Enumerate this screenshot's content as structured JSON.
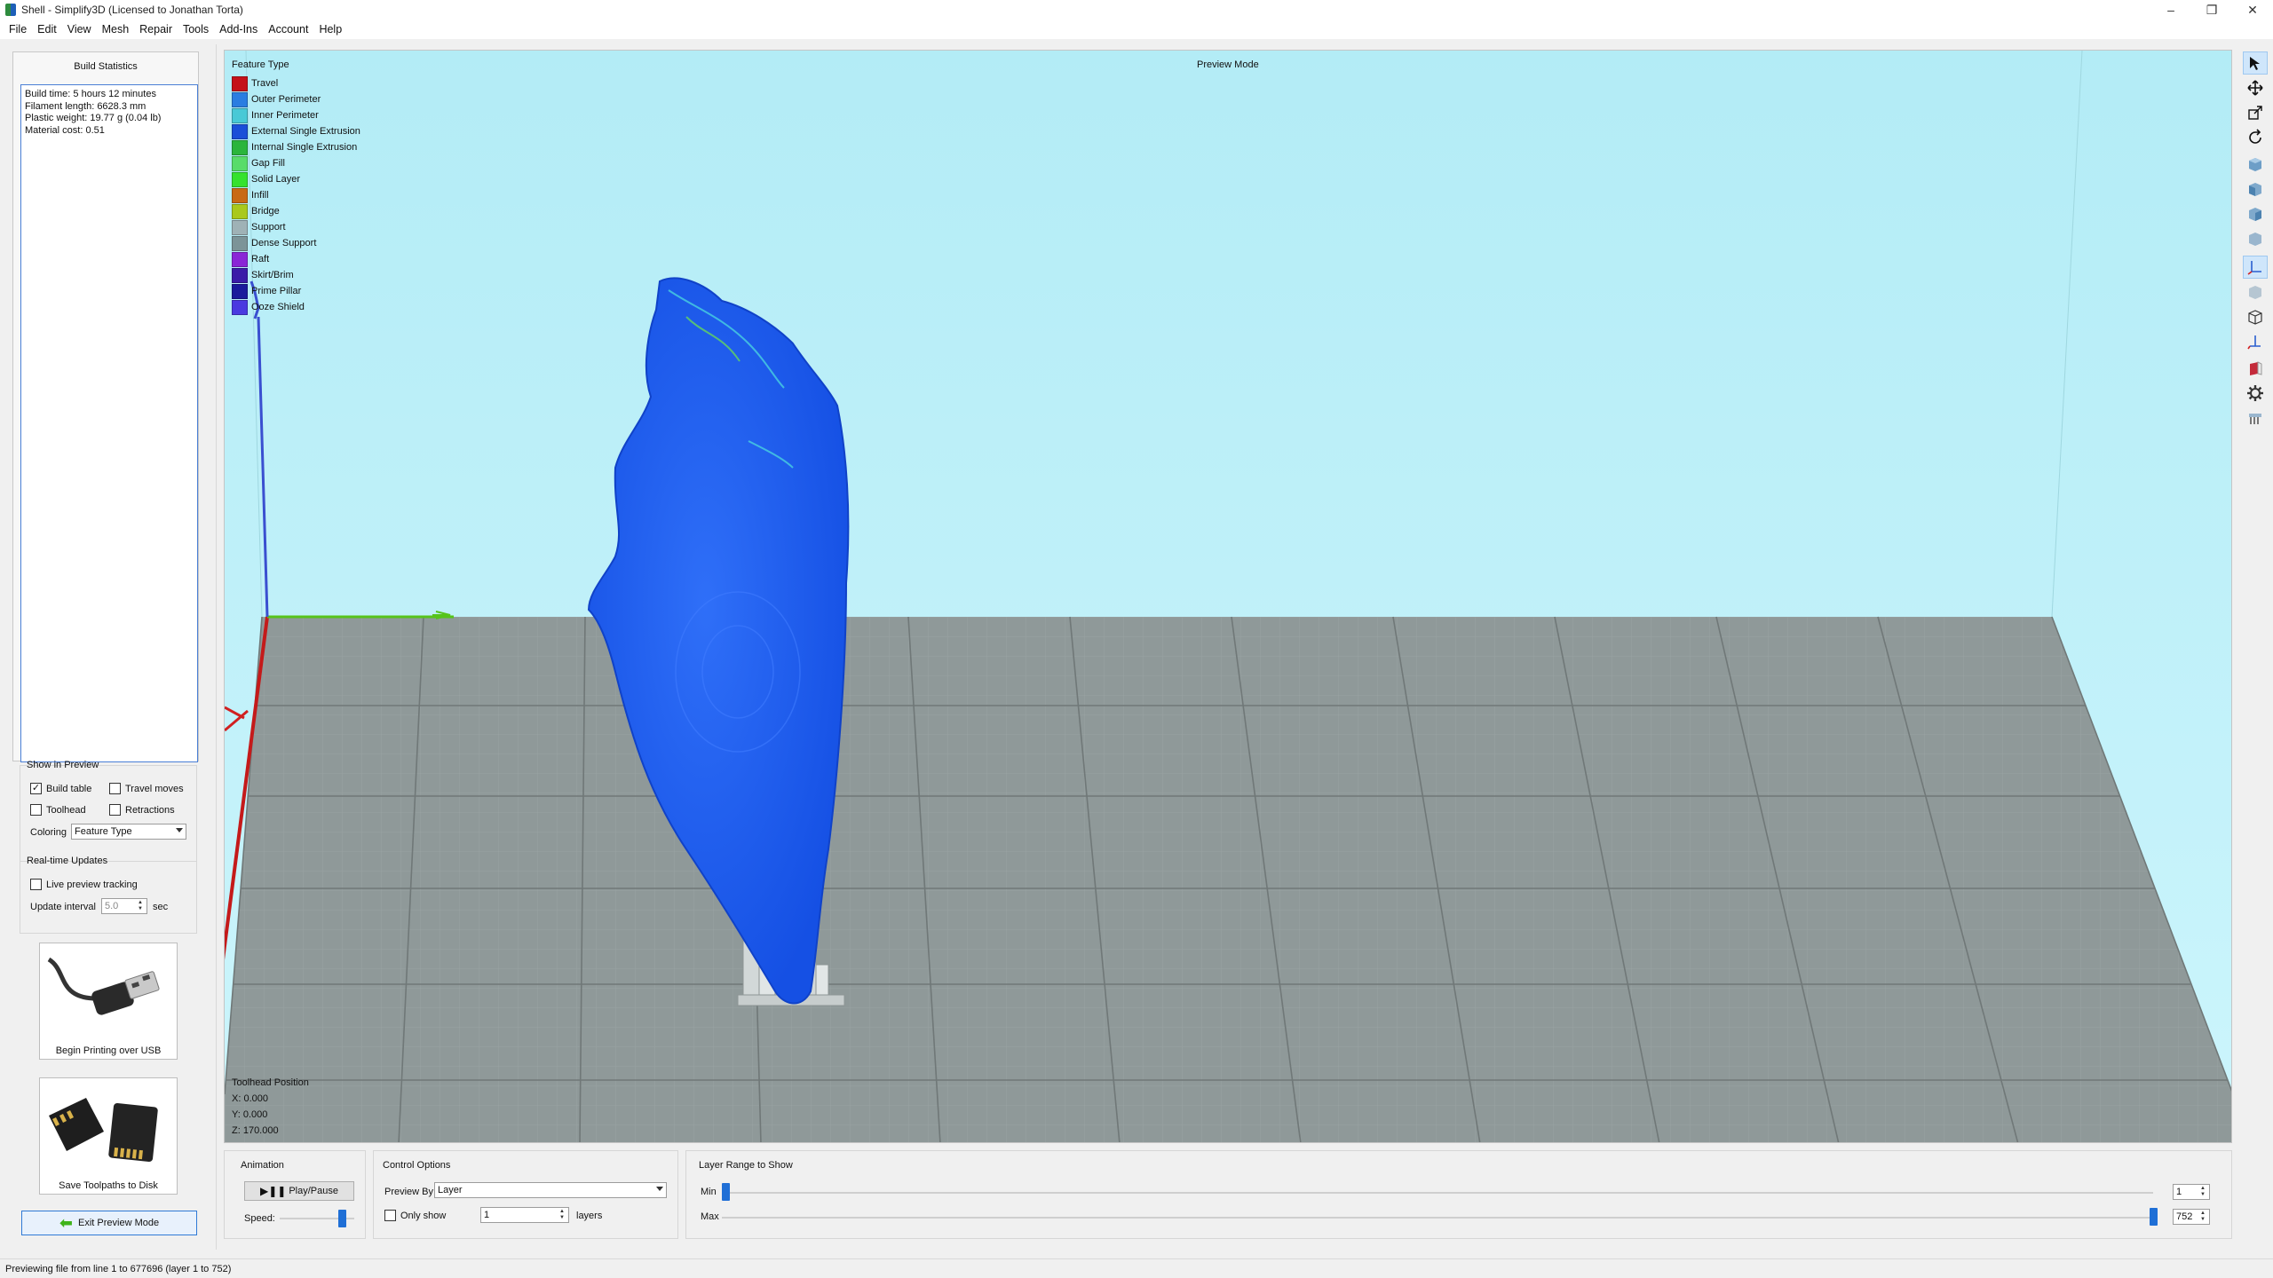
{
  "window": {
    "title": "Shell - Simplify3D (Licensed to Jonathan Torta)",
    "controls": [
      "–",
      "❐",
      "✕"
    ]
  },
  "menu": [
    "File",
    "Edit",
    "View",
    "Mesh",
    "Repair",
    "Tools",
    "Add-Ins",
    "Account",
    "Help"
  ],
  "build_stats": {
    "title": "Build Statistics",
    "lines": [
      "Build time: 5 hours 12 minutes",
      "Filament length: 6628.3 mm",
      "Plastic weight: 19.77 g (0.04 lb)",
      "Material cost: 0.51"
    ]
  },
  "show_in_preview": {
    "title": "Show in Preview",
    "build_table": {
      "label": "Build table",
      "checked": true
    },
    "travel_moves": {
      "label": "Travel moves",
      "checked": false
    },
    "toolhead": {
      "label": "Toolhead",
      "checked": false
    },
    "retractions": {
      "label": "Retractions",
      "checked": false
    },
    "coloring_label": "Coloring",
    "coloring_value": "Feature Type"
  },
  "realtime": {
    "title": "Real-time Updates",
    "live_tracking": {
      "label": "Live preview tracking",
      "checked": false
    },
    "interval_label": "Update interval",
    "interval_value": "5.0",
    "interval_unit": "sec"
  },
  "actions": {
    "usb_label": "Begin Printing over USB",
    "sd_label": "Save Toolpaths to Disk",
    "exit_label": "Exit Preview Mode"
  },
  "viewport": {
    "legend_title": "Feature Type",
    "mode_label": "Preview Mode",
    "legend": [
      {
        "label": "Travel",
        "color": "#c4121a"
      },
      {
        "label": "Outer Perimeter",
        "color": "#2a7de1"
      },
      {
        "label": "Inner Perimeter",
        "color": "#48c9d6"
      },
      {
        "label": "External Single Extrusion",
        "color": "#1a4fd8"
      },
      {
        "label": "Internal Single Extrusion",
        "color": "#2ab53c"
      },
      {
        "label": "Gap Fill",
        "color": "#58dc6a"
      },
      {
        "label": "Solid Layer",
        "color": "#35e22e"
      },
      {
        "label": "Infill",
        "color": "#c86a16"
      },
      {
        "label": "Bridge",
        "color": "#a9c91c"
      },
      {
        "label": "Support",
        "color": "#9fb2b6"
      },
      {
        "label": "Dense Support",
        "color": "#7c9498"
      },
      {
        "label": "Raft",
        "color": "#8a26d6"
      },
      {
        "label": "Skirt/Brim",
        "color": "#3a1ca8"
      },
      {
        "label": "Prime Pillar",
        "color": "#1a1a9c"
      },
      {
        "label": "Ooze Shield",
        "color": "#4a3ae0"
      }
    ],
    "toolhead_title": "Toolhead Position",
    "toolhead_x": "X: 0.000",
    "toolhead_y": "Y: 0.000",
    "toolhead_z": "Z: 170.000",
    "colors": {
      "background": "#c1f2fb",
      "bed": "#8e9898",
      "model": "#1e5ff2"
    }
  },
  "right_toolbar": [
    "select-icon",
    "move-icon",
    "scale-icon",
    "rotate-icon",
    "view-top-icon",
    "view-front-icon",
    "view-right-icon",
    "view-iso-icon",
    "axes-icon",
    "cube-icon",
    "wireframe-icon",
    "tool-icon",
    "cross-section-icon",
    "settings-gear-icon",
    "support-icon"
  ],
  "animation": {
    "title": "Animation",
    "play_label": "Play/Pause",
    "speed_label": "Speed:"
  },
  "control": {
    "title": "Control Options",
    "preview_by_label": "Preview By",
    "preview_by_value": "Layer",
    "only_show_label": "Only show",
    "only_show_value": "1",
    "layers_label": "layers"
  },
  "layer_range": {
    "title": "Layer Range to Show",
    "min_label": "Min",
    "max_label": "Max",
    "min_value": "1",
    "max_value": "752"
  },
  "status": "Previewing file from line 1 to 677696 (layer 1 to 752)"
}
